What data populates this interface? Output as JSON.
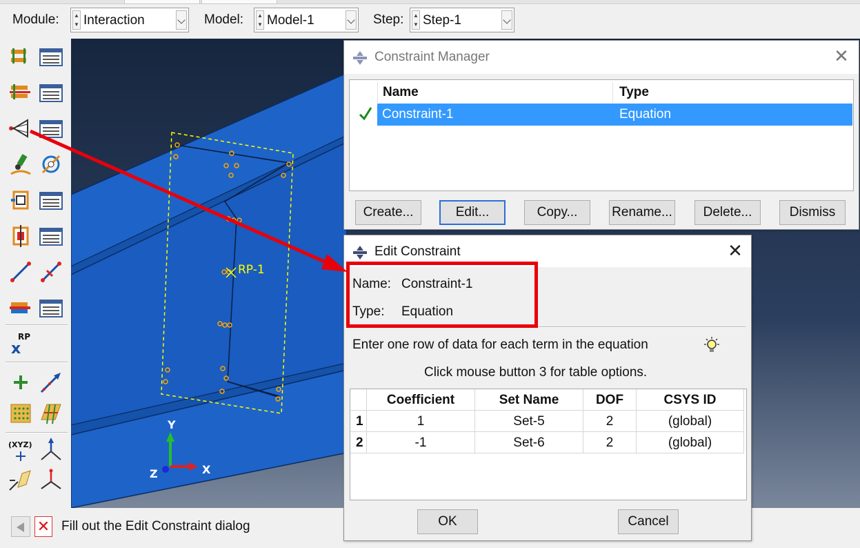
{
  "context_bar": {
    "module_label": "Module:",
    "module_value": "Interaction",
    "model_label": "Model:",
    "model_value": "Model-1",
    "step_label": "Step:",
    "step_value": "Step-1"
  },
  "toolbox": {
    "tools": [
      "create-interaction-icon",
      "interaction-manager-icon",
      "create-interaction-property-icon",
      "interaction-property-manager-icon",
      "create-constraint-icon",
      "constraint-manager-icon",
      "find-contact-pairs-icon",
      "create-connector-section-icon",
      "create-wire-feature-icon",
      "connector-section-manager-icon",
      "create-fastener-icon",
      "fastener-manager-icon",
      "create-wire-icon",
      "create-connector-assignment-icon",
      "create-amplitude-icon",
      "amplitude-manager-icon",
      "reference-point-icon",
      "create-inertia-icon",
      "create-crack-icon",
      "create-set-icon",
      "create-surface-icon",
      "create-datum-point-icon",
      "create-datum-axis-icon",
      "create-datum-plane-icon",
      "create-datum-csys-icon"
    ],
    "rp_label": "RP",
    "xyz_label": "(XYZ)"
  },
  "viewport": {
    "colors": {
      "background_top": "#16263f",
      "background_bottom": "#7a879b",
      "part_blue": "#1e64c8",
      "partition_yellow": "#ffff00",
      "marker_orange": "#ffa500"
    },
    "ref_point_label": "RP-1",
    "triad": {
      "x": "X",
      "y": "Y",
      "z": "Z"
    }
  },
  "constraint_manager": {
    "title": "Constraint Manager",
    "columns": [
      "Name",
      "Type"
    ],
    "rows": [
      {
        "name": "Constraint-1",
        "type": "Equation",
        "active": true
      }
    ],
    "buttons": {
      "create": "Create...",
      "edit": "Edit...",
      "copy": "Copy...",
      "rename": "Rename...",
      "delete": "Delete...",
      "dismiss": "Dismiss"
    }
  },
  "edit_constraint": {
    "title": "Edit Constraint",
    "name_label": "Name:",
    "name_value": "Constraint-1",
    "type_label": "Type:",
    "type_value": "Equation",
    "instruction_1": "Enter one row of data for each term in the equation",
    "instruction_2": "Click mouse button 3 for table options.",
    "columns": [
      "Coefficient",
      "Set Name",
      "DOF",
      "CSYS ID"
    ],
    "rows": [
      {
        "index": "1",
        "coefficient": "1",
        "set_name": "Set-5",
        "dof": "2",
        "csys_id": "(global)"
      },
      {
        "index": "2",
        "coefficient": "-1",
        "set_name": "Set-6",
        "dof": "2",
        "csys_id": "(global)"
      }
    ],
    "buttons": {
      "ok": "OK",
      "cancel": "Cancel"
    }
  },
  "status_bar": {
    "message": "Fill out the Edit Constraint dialog"
  },
  "annotation": {
    "highlight_color": "#e8000b"
  }
}
